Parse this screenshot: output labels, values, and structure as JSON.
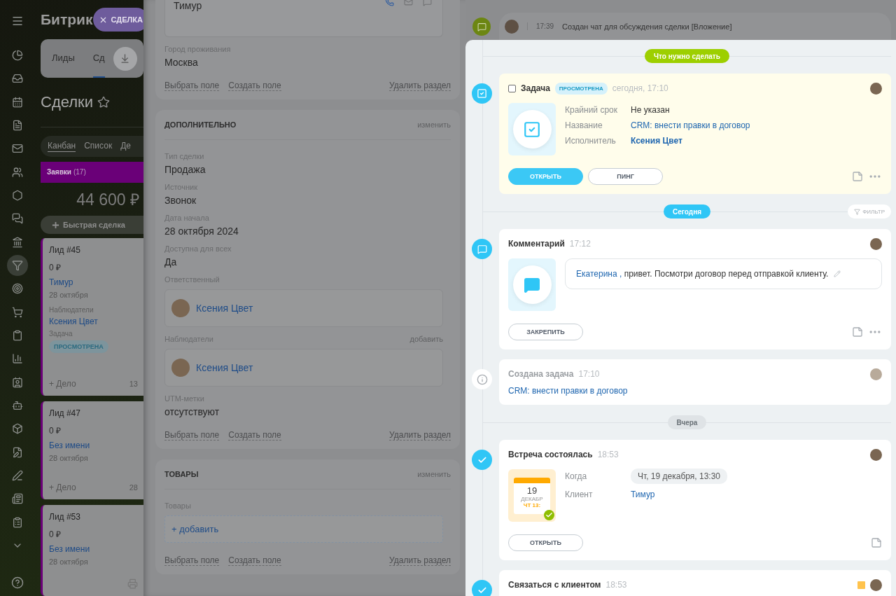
{
  "sidebar": {
    "items": [
      {
        "selected": false
      },
      {
        "selected": false
      },
      {
        "selected": false
      },
      {
        "selected": false
      },
      {
        "selected": false
      },
      {
        "selected": false
      },
      {
        "selected": false
      },
      {
        "selected": false
      },
      {
        "selected": false
      },
      {
        "selected": true
      },
      {
        "selected": false
      },
      {
        "selected": false
      },
      {
        "selected": false
      },
      {
        "selected": false
      },
      {
        "selected": false
      },
      {
        "selected": false
      },
      {
        "selected": false
      },
      {
        "selected": false
      },
      {
        "selected": false
      },
      {
        "selected": false
      },
      {
        "selected": false
      },
      {
        "selected": false
      }
    ]
  },
  "header": {
    "logo": "Битрик",
    "close_chip": "СДЕЛКА"
  },
  "tabs": [
    {
      "label": "Лиды",
      "selected": false
    },
    {
      "label": "Сд",
      "selected": true
    }
  ],
  "page_title": "Сделки",
  "views": [
    {
      "label": "Канбан",
      "selected": true
    },
    {
      "label": "Список",
      "selected": false
    },
    {
      "label": "Де",
      "selected": false
    }
  ],
  "kanban_column": {
    "title": "Заявки",
    "count": "(17)",
    "total": "44 600 ₽",
    "quick_add": "Быстрая сделка"
  },
  "kanban_cards": [
    {
      "title": "Лид #45",
      "amount": "0 ₽",
      "contact": "Тимур",
      "date": "28 октября",
      "fields": [
        {
          "kind": "person",
          "label": "Наблюдатели",
          "value": "Ксения Цвет"
        },
        {
          "kind": "badge",
          "label": "Задача",
          "value": "ПРОСМОТРЕНА"
        }
      ],
      "add": "+ Дело",
      "footer_date": "13"
    },
    {
      "title": "Лид #47",
      "amount": "0 ₽",
      "contact": "Без имени",
      "date": "28 октября",
      "add": "+ Дело",
      "footer_date": "28"
    },
    {
      "title": "Лид #53",
      "amount": "0 ₽",
      "contact": "Без имени",
      "date": "28 октября"
    }
  ],
  "deal_sections": [
    {
      "kind": "contact",
      "contact_name": "Тимур",
      "fields": [
        {
          "kind": "text",
          "label": "Город проживания",
          "value": "Москва"
        }
      ],
      "links": [
        "Выбрать поле",
        "Создать поле"
      ],
      "delete": "Удалить раздел"
    },
    {
      "kind": "section",
      "title": "ДОПОЛНИТЕЛЬНО",
      "action": "изменить",
      "fields": [
        {
          "kind": "text",
          "label": "Тип сделки",
          "value": "Продажа"
        },
        {
          "kind": "text",
          "label": "Источник",
          "value": "Звонок"
        },
        {
          "kind": "text",
          "label": "Дата начала",
          "value": "28 октября 2024"
        },
        {
          "kind": "text",
          "label": "Доступна для всех",
          "value": "Да"
        },
        {
          "kind": "person",
          "label": "Ответственный",
          "value": "Ксения Цвет"
        },
        {
          "kind": "person",
          "label": "Наблюдатели",
          "action": "добавить",
          "value": "Ксения Цвет"
        },
        {
          "kind": "text",
          "label": "UTM-метки",
          "value": "отсутствуют"
        }
      ],
      "links": [
        "Выбрать поле",
        "Создать поле"
      ],
      "delete": "Удалить раздел"
    },
    {
      "kind": "section",
      "title": "ТОВАРЫ",
      "action": "изменить",
      "fields": [
        {
          "kind": "add",
          "label": "Товары",
          "value": "+ добавить"
        }
      ],
      "links": [
        "Выбрать поле",
        "Создать поле"
      ],
      "delete": "Удалить раздел"
    }
  ],
  "timeline_top": {
    "time": "17:39",
    "text": "Создан чат для обсуждения сделки [Вложение]"
  },
  "timeline": [
    {
      "kind": "todo",
      "label": "Что нужно сделать"
    },
    {
      "kind": "task",
      "title": "Задача",
      "checked": false,
      "badge": "ПРОСМОТРЕНА",
      "time": "сегодня, 17:10",
      "flagged": false,
      "fields": [
        {
          "kind": "text",
          "label": "Крайний срок",
          "value": "Не указан"
        },
        {
          "kind": "link",
          "label": "Название",
          "value": "CRM: внести правки в договор"
        },
        {
          "kind": "bold-link",
          "label": "Исполнитель",
          "value": "Ксения Цвет"
        }
      ],
      "buttons": [
        {
          "label": "ОТКРЫТЬ",
          "primary": true
        },
        {
          "label": "ПИНГ",
          "primary": false
        }
      ],
      "more": true
    },
    {
      "kind": "today",
      "label": "Сегодня",
      "filter": "ФИЛЬТР"
    },
    {
      "kind": "comment",
      "title": "Комментарий",
      "time": "17:12",
      "flagged": false,
      "mention": "Екатерина ,",
      "text": "привет. Посмотри договор перед отправкой клиенту.",
      "buttons": [
        {
          "label": "ЗАКРЕПИТЬ",
          "primary": false
        }
      ],
      "more": true
    },
    {
      "kind": "info",
      "title": "Создана задача",
      "time": "17:10",
      "flagged": false,
      "link": "CRM: внести правки в договор"
    },
    {
      "kind": "past",
      "label": "Вчера"
    },
    {
      "kind": "meeting",
      "title": "Встреча состоялась",
      "time": "18:53",
      "flagged": false,
      "calendar": {
        "day": "19",
        "month": "ДЕКАБР",
        "weekday_time": "ЧТ 13:"
      },
      "fields": [
        {
          "kind": "chip",
          "label": "Когда",
          "value": "Чт, 19 декабря, 13:30"
        },
        {
          "kind": "link",
          "label": "Клиент",
          "value": "Тимур"
        }
      ],
      "buttons": [
        {
          "label": "ОТКРЫТЬ",
          "primary": false
        }
      ],
      "more": false
    },
    {
      "kind": "call",
      "title": "Связаться с клиентом",
      "time": "18:53",
      "flagged": true
    }
  ]
}
